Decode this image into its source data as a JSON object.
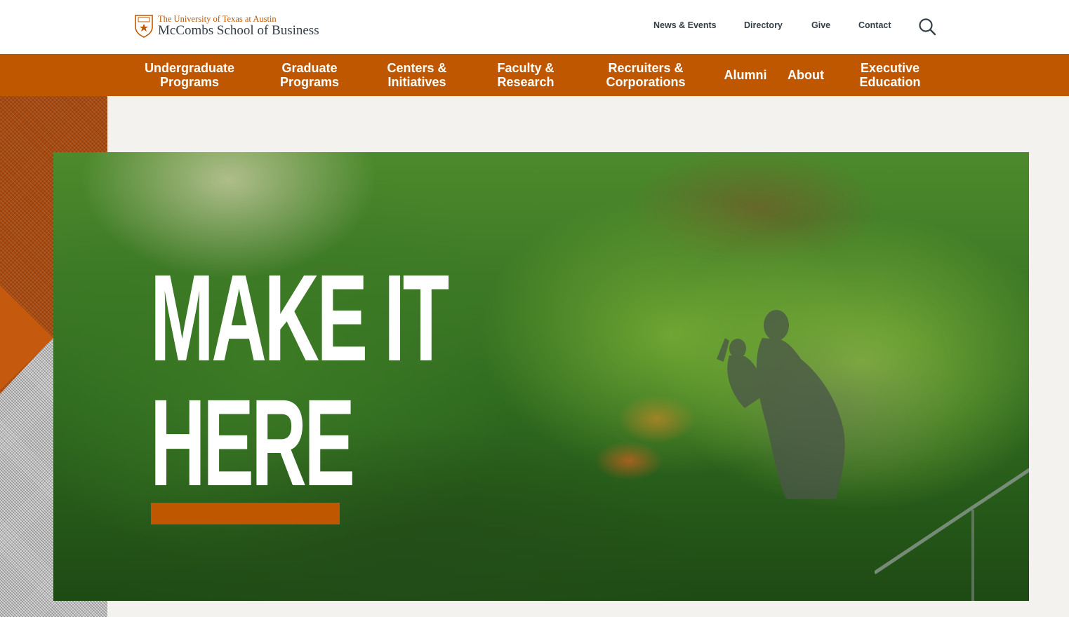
{
  "header": {
    "university": "The University of Texas at Austin",
    "school": "McCombs School of Business",
    "utility_links": [
      "News & Events",
      "Directory",
      "Give",
      "Contact"
    ],
    "search_icon": "search-icon"
  },
  "nav": {
    "items": [
      "Undergraduate\nPrograms",
      "Graduate\nPrograms",
      "Centers &\nInitiatives",
      "Faculty &\nResearch",
      "Recruiters &\nCorporations",
      "Alumni",
      "About",
      "Executive\nEducation"
    ]
  },
  "hero": {
    "headline": "MAKE IT\nHERE"
  },
  "colors": {
    "burnt_orange": "#bf5700",
    "charcoal": "#333f48",
    "page_bg": "#f4f2ef"
  }
}
